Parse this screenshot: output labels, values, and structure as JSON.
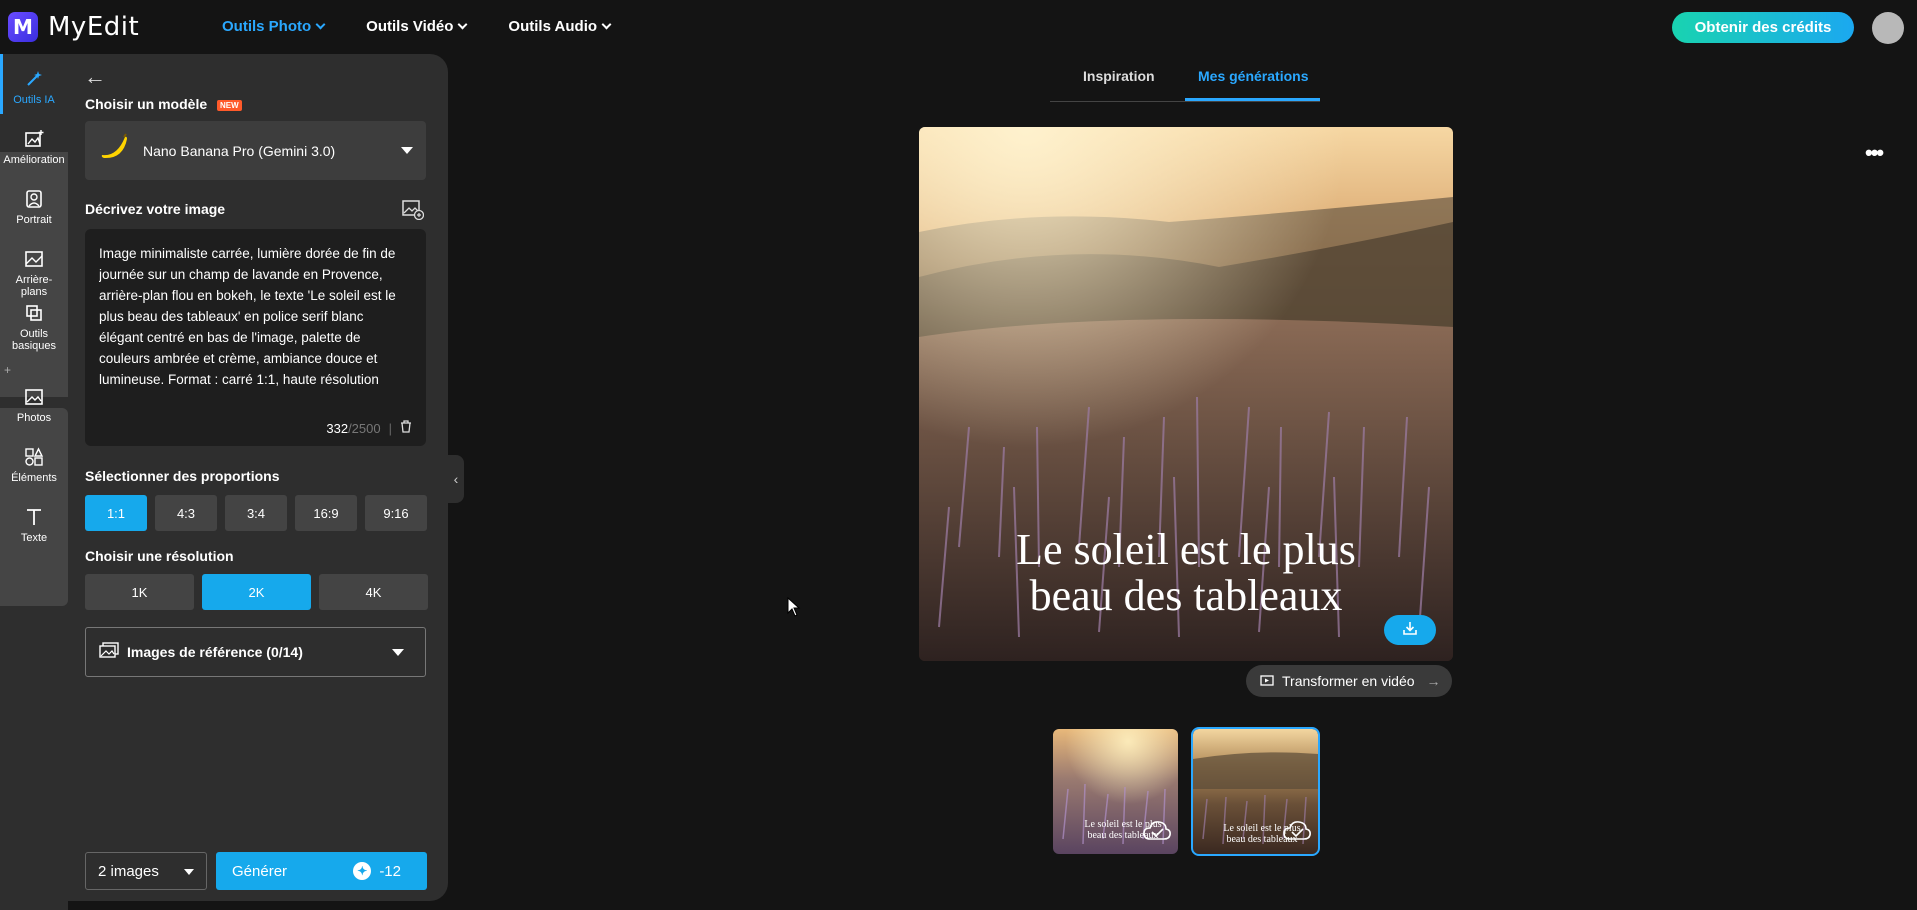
{
  "app": {
    "logo_letter": "M",
    "name": "MyEdit"
  },
  "topnav": [
    {
      "label": "Outils Photo",
      "active": true
    },
    {
      "label": "Outils Vidéo",
      "active": false
    },
    {
      "label": "Outils Audio",
      "active": false
    }
  ],
  "header": {
    "credits_button": "Obtenir des crédits"
  },
  "rail": [
    {
      "label": "Outils IA",
      "icon": "magic-wand-icon",
      "active": true
    },
    {
      "label": "Amélioration",
      "icon": "image-enhance-icon"
    },
    {
      "label": "Portrait",
      "icon": "portrait-icon"
    },
    {
      "label": "Arrière-plans",
      "icon": "background-icon"
    },
    {
      "label": "Outils basiques",
      "icon": "layers-icon"
    },
    {
      "label": "Photos",
      "icon": "photo-icon"
    },
    {
      "label": "Éléments",
      "icon": "shapes-icon"
    },
    {
      "label": "Texte",
      "icon": "text-icon"
    }
  ],
  "panel": {
    "model_label": "Choisir un modèle",
    "new_badge": "NEW",
    "model_value": "Nano Banana Pro (Gemini 3.0)",
    "describe_label": "Décrivez votre image",
    "prompt": "Image minimaliste carrée, lumière dorée de fin de journée sur un champ de lavande en Provence, arrière-plan flou en bokeh, le texte 'Le soleil est le plus beau des tableaux' en police serif blanc élégant centré en bas de l'image, palette de couleurs ambrée et crème, ambiance douce et lumineuse. Format : carré 1:1, haute résolution",
    "char_count": "332",
    "char_max": "/2500",
    "char_sep": "|",
    "ratio_label": "Sélectionner des proportions",
    "ratios": [
      "1:1",
      "4:3",
      "3:4",
      "16:9",
      "9:16"
    ],
    "ratio_selected": "1:1",
    "resolution_label": "Choisir une résolution",
    "resolutions": [
      "1K",
      "2K",
      "4K"
    ],
    "resolution_selected": "2K",
    "reference_label": "Images de référence (0/14)",
    "image_count": "2 images",
    "generate_label": "Générer",
    "generate_cost": "-12"
  },
  "tabs": [
    {
      "label": "Inspiration",
      "active": false
    },
    {
      "label": "Mes générations",
      "active": true
    }
  ],
  "result": {
    "caption_line1": "Le soleil est le plus",
    "caption_line2": "beau des tableaux",
    "transform_button": "Transformer en vidéo"
  },
  "thumbnails": [
    {
      "caption_line1": "Le soleil est le plus",
      "caption_line2": "beau des tableaux",
      "selected": false
    },
    {
      "caption_line1": "Le soleil est le plus",
      "caption_line2": "beau des tableaux",
      "selected": true
    }
  ],
  "colors": {
    "accent": "#16a9ec",
    "panel": "#2e2e2e",
    "background": "#141414"
  }
}
